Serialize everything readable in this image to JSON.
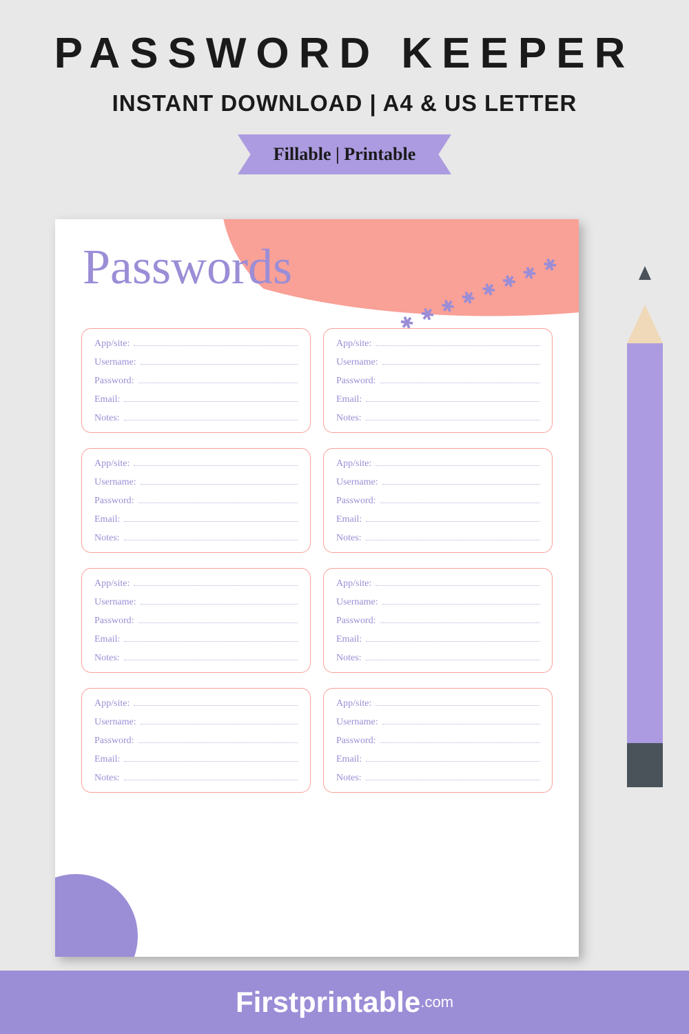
{
  "header": {
    "title": "PASSWORD KEEPER",
    "subtitle": "INSTANT DOWNLOAD | A4 & US LETTER",
    "ribbon": "Fillable | Printable"
  },
  "page": {
    "heading": "Passwords",
    "fields": [
      "App/site:",
      "Username:",
      "Password:",
      "Email:",
      "Notes:"
    ],
    "card_count": 8
  },
  "footer": {
    "brand": "Firstprintable",
    "domain": ".com"
  },
  "colors": {
    "purple": "#9b8dd6",
    "light_purple": "#ac9be0",
    "coral": "#f9a097",
    "bg": "#e8e8e8"
  }
}
